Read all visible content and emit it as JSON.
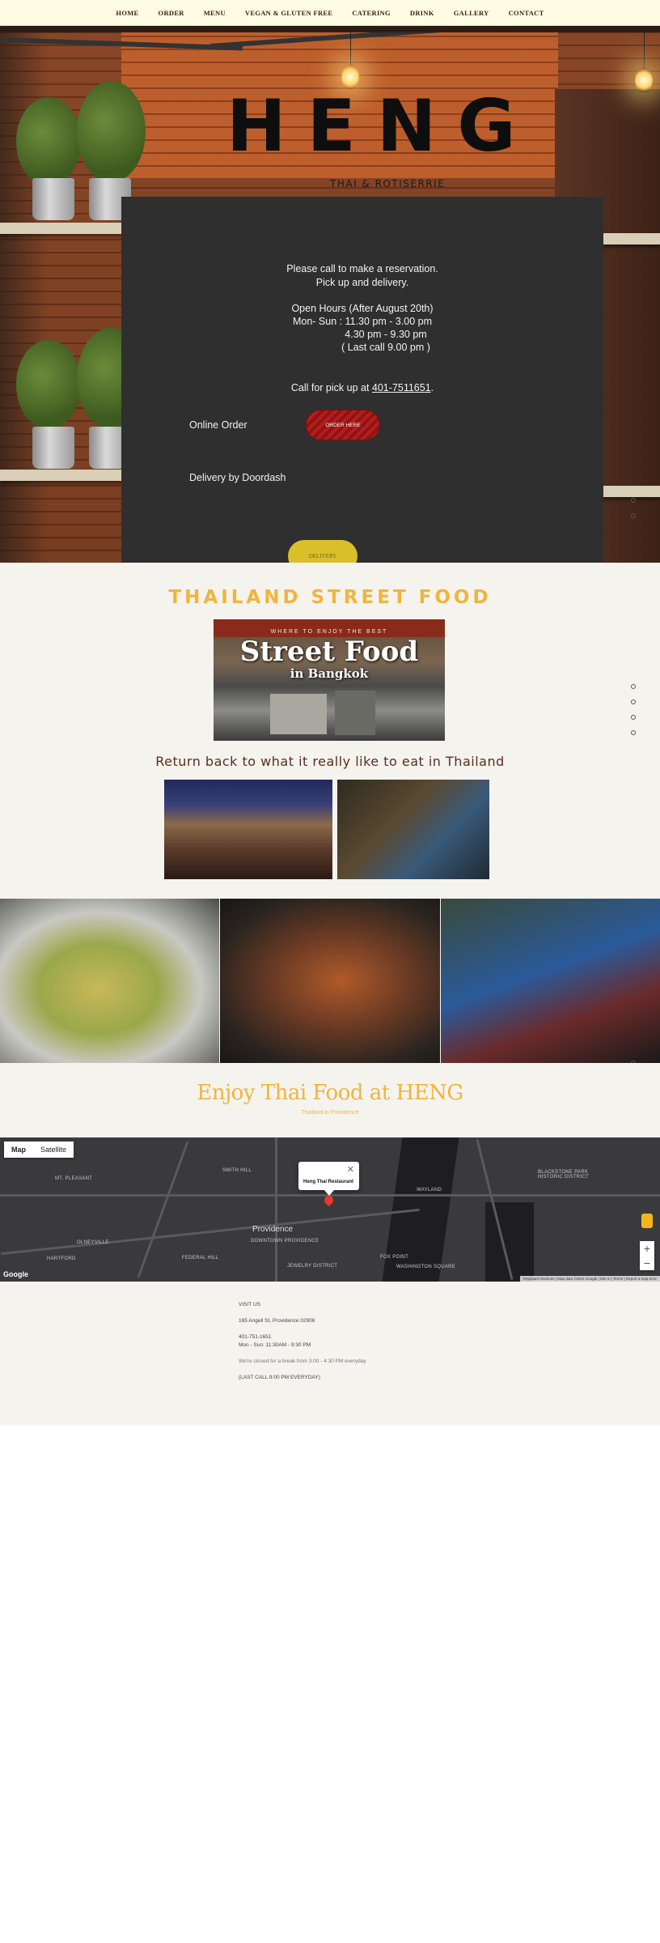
{
  "nav": {
    "items": [
      "HOME",
      "ORDER",
      "MENU",
      "VEGAN & GLUTEN FREE",
      "CATERING",
      "DRINK",
      "GALLERY",
      "CONTACT"
    ]
  },
  "hero": {
    "logo": "HENG",
    "logo_sub": "THAI & ROTISERRIE"
  },
  "panel": {
    "line1": "Please call to make a reservation.",
    "line2": "Pick up and delivery.",
    "hours_title": "Open Hours (After August 20th)",
    "hours1": "Mon- Sun : 11.30 pm - 3.00 pm",
    "hours2": "4.30 pm - 9.30 pm",
    "hours3": "( Last call 9.00 pm )",
    "call_prefix": "Call for pick up at ",
    "phone": "401-7511651",
    "call_suffix": ".",
    "online_order": "Online Order",
    "order_button": "ORDER HERE",
    "delivery_text": "Delivery by Doordash",
    "delivery_button": "DELIVERY"
  },
  "street": {
    "title": "THAILAND STREET FOOD",
    "img_small": "WHERE TO ENJOY THE BEST",
    "img_big": "Street Food",
    "img_sub": "in Bangkok",
    "return_title": "Return back to what it really like to eat in Thailand"
  },
  "enjoy": {
    "title": "Enjoy Thai Food at HENG",
    "subtitle": "Thailand in Providence"
  },
  "map": {
    "tab_map": "Map",
    "tab_satellite": "Satellite",
    "marker_name": "Heng Thai Restaurant",
    "city": "Providence",
    "labels": [
      "BLACKSTONE PARK HISTORIC DISTRICT",
      "WAYLAND",
      "FOX POINT",
      "SMITH HILL",
      "MT. PLEASANT",
      "FEDERAL HILL",
      "OLNEYVILLE",
      "DOWNTOWN PROVIDENCE",
      "JEWELRY DISTRICT",
      "WASHINGTON SQUARE",
      "HARTFORD"
    ],
    "google": "Google",
    "footer": "Keyboard shortcuts | Map data ©2021 Google | 500 m | Terms | Report a map error"
  },
  "address": {
    "heading": "VISIT US",
    "street": "165 Angell St, Providence 02906",
    "phone": "401-751-1651",
    "hours": "Mon - Sun: 11:30AM - 9:30 PM",
    "break": "We're closed for a break from 3:00 - 4:30 PM everyday",
    "last_call": "(LAST CALL 9:00 PM EVERYDAY)"
  },
  "colors": {
    "accent": "#f0b53c",
    "order": "#b71c1c",
    "delivery": "#d9c02a",
    "panel": "#2f2f2f",
    "nav_bg": "#fefde4"
  }
}
